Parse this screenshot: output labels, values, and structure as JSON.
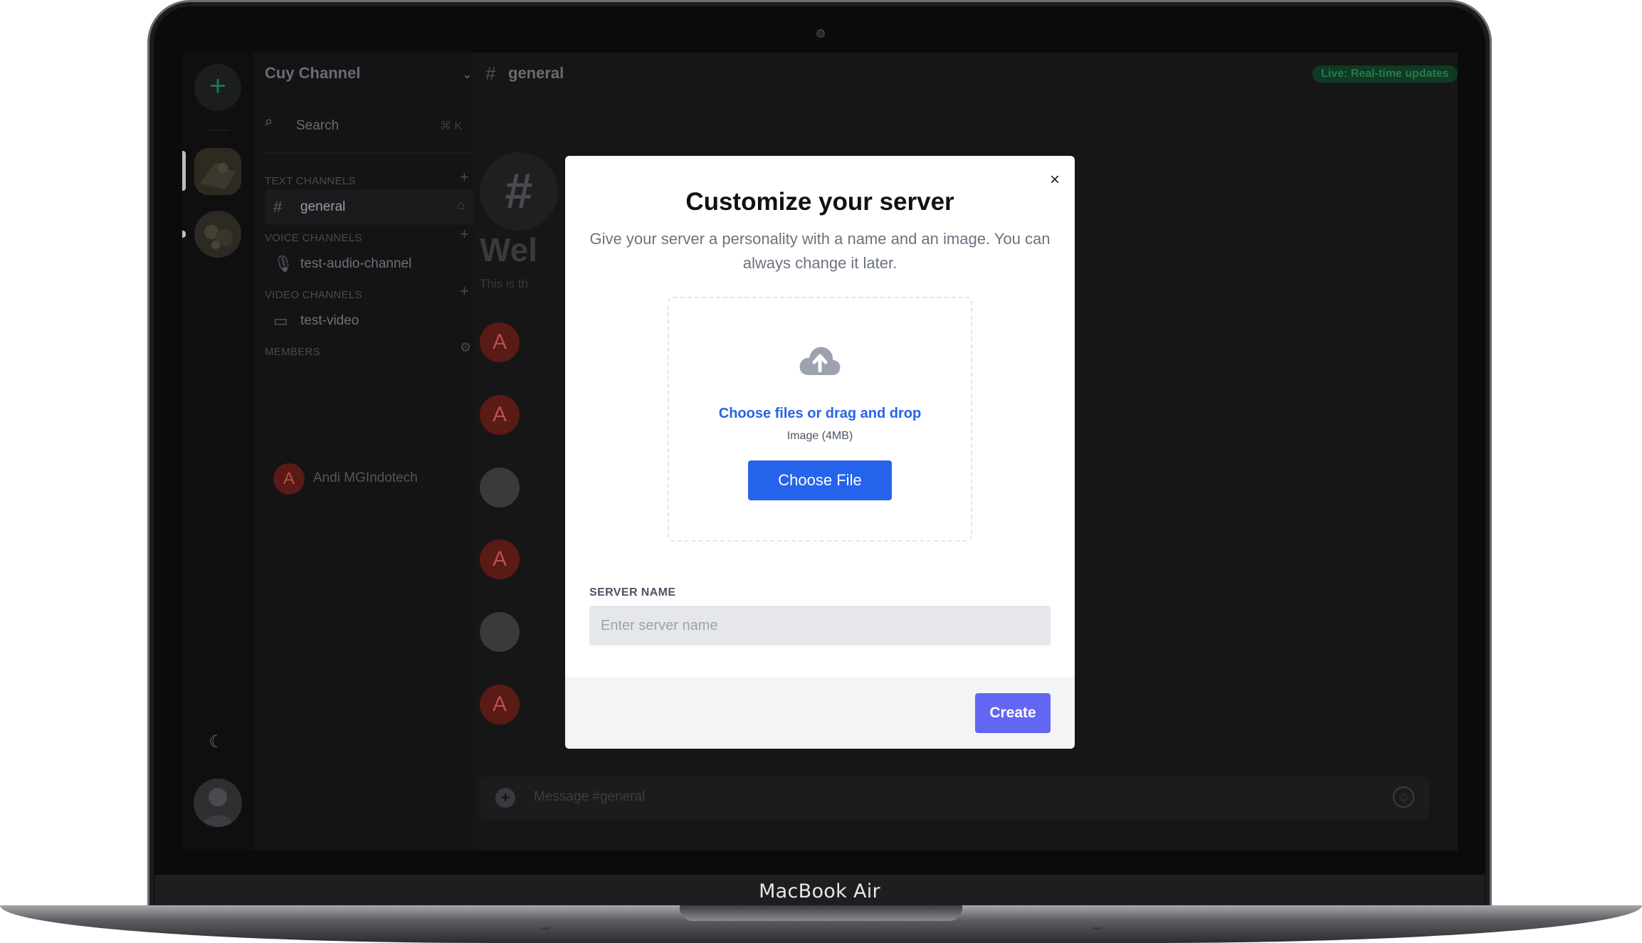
{
  "device": {
    "label": "MacBook Air"
  },
  "sidebar": {
    "server_name": "Cuy Channel",
    "search_label": "Search",
    "search_shortcut": "⌘ K",
    "sections": {
      "text": "TEXT CHANNELS",
      "voice": "VOICE CHANNELS",
      "video": "VIDEO CHANNELS",
      "members": "MEMBERS"
    },
    "channels": {
      "text": "general",
      "voice": "test-audio-channel",
      "video": "test-video"
    },
    "member": {
      "initial": "A",
      "name": "Andi MGIndotech"
    }
  },
  "header": {
    "channel_name": "general",
    "live_badge": "Live: Real-time updates"
  },
  "chat": {
    "welcome_title": "Wel",
    "welcome_sub": "This is th",
    "message_avatars": [
      "A",
      "A",
      "",
      "A",
      "",
      "A"
    ],
    "input_placeholder": "Message #general"
  },
  "modal": {
    "title": "Customize your server",
    "description": "Give your server a personality with a name and an image. You can always change it later.",
    "upload": {
      "link_text": "Choose files or drag and drop",
      "hint": "Image (4MB)",
      "button_label": "Choose File"
    },
    "server_name_label": "SERVER NAME",
    "server_name_placeholder": "Enter server name",
    "server_name_value": "",
    "create_label": "Create",
    "close_symbol": "×"
  },
  "colors": {
    "primary_blue": "#2563eb",
    "create_indigo": "#6366f1",
    "live_green": "#27794f"
  }
}
